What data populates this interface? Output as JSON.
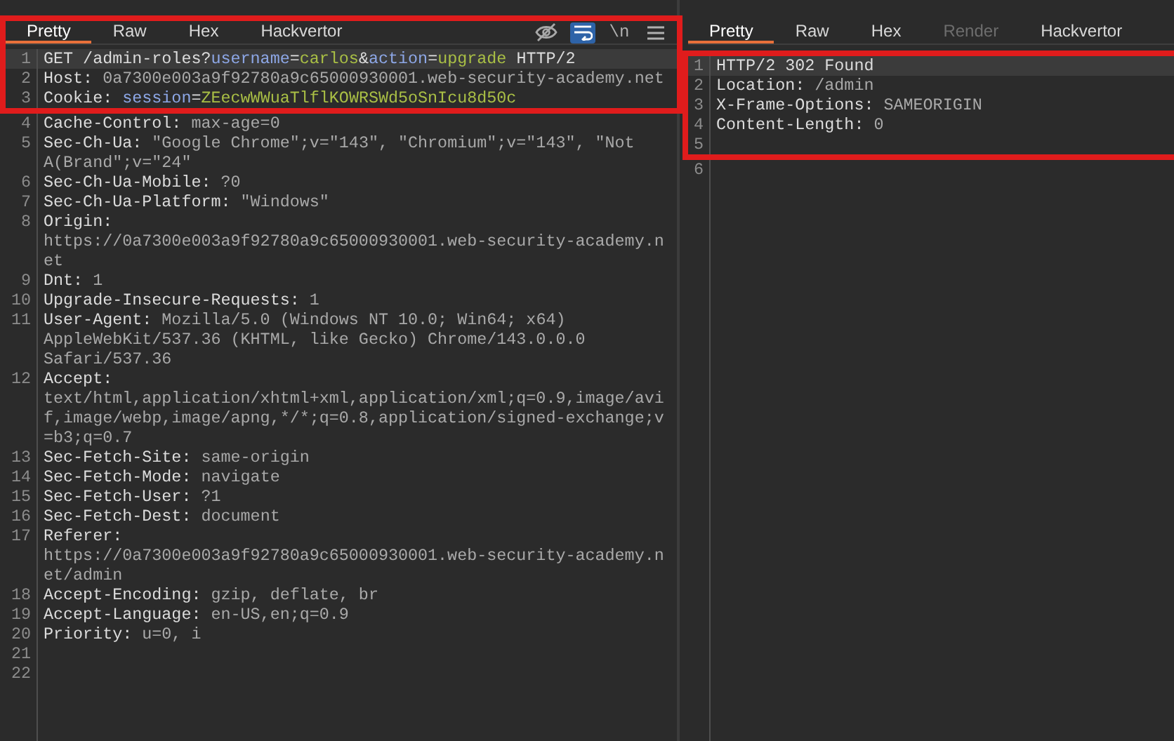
{
  "request": {
    "frame_includes_tabs": true,
    "tabs": [
      {
        "label": "Pretty",
        "selected": true,
        "disabled": false
      },
      {
        "label": "Raw",
        "selected": false,
        "disabled": false
      },
      {
        "label": "Hex",
        "selected": false,
        "disabled": false
      },
      {
        "label": "Hackvertor",
        "selected": false,
        "disabled": false
      }
    ],
    "toolbar": [
      {
        "kind": "hide_toggle",
        "on": false
      },
      {
        "kind": "wrap_toggle",
        "on": true
      },
      {
        "kind": "newline_toggle",
        "label": "\\n",
        "on": false
      },
      {
        "kind": "menu",
        "on": false
      }
    ],
    "framed_lines": [
      {
        "number": "1",
        "current": true,
        "rows": [
          [
            {
              "kind": "name",
              "text": "GET /admin-roles?"
            },
            {
              "kind": "param",
              "text": "username"
            },
            {
              "kind": "name",
              "text": "="
            },
            {
              "kind": "param_value",
              "text": "carlos"
            },
            {
              "kind": "name",
              "text": "&"
            },
            {
              "kind": "param",
              "text": "action"
            },
            {
              "kind": "name",
              "text": "="
            },
            {
              "kind": "param_value",
              "text": "upgrade"
            },
            {
              "kind": "name",
              "text": " HTTP/2"
            }
          ]
        ]
      },
      {
        "number": "2",
        "current": false,
        "rows": [
          [
            {
              "kind": "name",
              "text": "Host:"
            },
            {
              "kind": "value",
              "text": " 0a7300e003a9f92780a9c65000930001.web-security-academy.net"
            }
          ]
        ]
      },
      {
        "number": "3",
        "current": false,
        "rows": [
          [
            {
              "kind": "name",
              "text": "Cookie: "
            },
            {
              "kind": "param",
              "text": "session"
            },
            {
              "kind": "name",
              "text": "="
            },
            {
              "kind": "param_value",
              "text": "ZEecwWWuaTlflKOWRSWd5oSnIcu8d50c"
            }
          ]
        ]
      }
    ],
    "lines": [
      {
        "number": "4",
        "current": false,
        "rows": [
          [
            {
              "kind": "name",
              "text": "Cache-Control:"
            },
            {
              "kind": "value",
              "text": " max-age=0"
            }
          ]
        ]
      },
      {
        "number": "5",
        "current": false,
        "rows": [
          [
            {
              "kind": "name",
              "text": "Sec-Ch-Ua:"
            },
            {
              "kind": "value",
              "text": " \"Google Chrome\";v=\"143\", \"Chromium\";v=\"143\", \"Not"
            }
          ],
          [
            {
              "kind": "value",
              "text": "A(Brand\";v=\"24\""
            }
          ]
        ]
      },
      {
        "number": "6",
        "current": false,
        "rows": [
          [
            {
              "kind": "name",
              "text": "Sec-Ch-Ua-Mobile:"
            },
            {
              "kind": "value",
              "text": " ?0"
            }
          ]
        ]
      },
      {
        "number": "7",
        "current": false,
        "rows": [
          [
            {
              "kind": "name",
              "text": "Sec-Ch-Ua-Platform:"
            },
            {
              "kind": "value",
              "text": " \"Windows\""
            }
          ]
        ]
      },
      {
        "number": "8",
        "current": false,
        "rows": [
          [
            {
              "kind": "name",
              "text": "Origin:"
            }
          ],
          [
            {
              "kind": "value",
              "text": "https://0a7300e003a9f92780a9c65000930001.web-security-academy.n"
            }
          ],
          [
            {
              "kind": "value",
              "text": "et"
            }
          ]
        ]
      },
      {
        "number": "9",
        "current": false,
        "rows": [
          [
            {
              "kind": "name",
              "text": "Dnt:"
            },
            {
              "kind": "value",
              "text": " 1"
            }
          ]
        ]
      },
      {
        "number": "10",
        "current": false,
        "rows": [
          [
            {
              "kind": "name",
              "text": "Upgrade-Insecure-Requests:"
            },
            {
              "kind": "value",
              "text": " 1"
            }
          ]
        ]
      },
      {
        "number": "11",
        "current": false,
        "rows": [
          [
            {
              "kind": "name",
              "text": "User-Agent:"
            },
            {
              "kind": "value",
              "text": " Mozilla/5.0 (Windows NT 10.0; Win64; x64)"
            }
          ],
          [
            {
              "kind": "value",
              "text": "AppleWebKit/537.36 (KHTML, like Gecko) Chrome/143.0.0.0"
            }
          ],
          [
            {
              "kind": "value",
              "text": "Safari/537.36"
            }
          ]
        ]
      },
      {
        "number": "12",
        "current": false,
        "rows": [
          [
            {
              "kind": "name",
              "text": "Accept:"
            }
          ],
          [
            {
              "kind": "value",
              "text": "text/html,application/xhtml+xml,application/xml;q=0.9,image/avi"
            }
          ],
          [
            {
              "kind": "value",
              "text": "f,image/webp,image/apng,*/*;q=0.8,application/signed-exchange;v"
            }
          ],
          [
            {
              "kind": "value",
              "text": "=b3;q=0.7"
            }
          ]
        ]
      },
      {
        "number": "13",
        "current": false,
        "rows": [
          [
            {
              "kind": "name",
              "text": "Sec-Fetch-Site:"
            },
            {
              "kind": "value",
              "text": " same-origin"
            }
          ]
        ]
      },
      {
        "number": "14",
        "current": false,
        "rows": [
          [
            {
              "kind": "name",
              "text": "Sec-Fetch-Mode:"
            },
            {
              "kind": "value",
              "text": " navigate"
            }
          ]
        ]
      },
      {
        "number": "15",
        "current": false,
        "rows": [
          [
            {
              "kind": "name",
              "text": "Sec-Fetch-User:"
            },
            {
              "kind": "value",
              "text": " ?1"
            }
          ]
        ]
      },
      {
        "number": "16",
        "current": false,
        "rows": [
          [
            {
              "kind": "name",
              "text": "Sec-Fetch-Dest:"
            },
            {
              "kind": "value",
              "text": " document"
            }
          ]
        ]
      },
      {
        "number": "17",
        "current": false,
        "rows": [
          [
            {
              "kind": "name",
              "text": "Referer:"
            }
          ],
          [
            {
              "kind": "value",
              "text": "https://0a7300e003a9f92780a9c65000930001.web-security-academy.n"
            }
          ],
          [
            {
              "kind": "value",
              "text": "et/admin"
            }
          ]
        ]
      },
      {
        "number": "18",
        "current": false,
        "rows": [
          [
            {
              "kind": "name",
              "text": "Accept-Encoding:"
            },
            {
              "kind": "value",
              "text": " gzip, deflate, br"
            }
          ]
        ]
      },
      {
        "number": "19",
        "current": false,
        "rows": [
          [
            {
              "kind": "name",
              "text": "Accept-Language:"
            },
            {
              "kind": "value",
              "text": " en-US,en;q=0.9"
            }
          ]
        ]
      },
      {
        "number": "20",
        "current": false,
        "rows": [
          [
            {
              "kind": "name",
              "text": "Priority:"
            },
            {
              "kind": "value",
              "text": " u=0, i"
            }
          ]
        ]
      },
      {
        "number": "21",
        "current": false
      },
      {
        "number": "22",
        "current": false
      }
    ]
  },
  "response": {
    "frame_includes_tabs": false,
    "tabs": [
      {
        "label": "Pretty",
        "selected": true,
        "disabled": false
      },
      {
        "label": "Raw",
        "selected": false,
        "disabled": false
      },
      {
        "label": "Hex",
        "selected": false,
        "disabled": false
      },
      {
        "label": "Render",
        "selected": false,
        "disabled": true
      },
      {
        "label": "Hackvertor",
        "selected": false,
        "disabled": false
      }
    ],
    "framed_lines": [
      {
        "number": "1",
        "current": true,
        "rows": [
          [
            {
              "kind": "name",
              "text": "HTTP/2 302 Found"
            }
          ]
        ]
      },
      {
        "number": "2",
        "current": false,
        "rows": [
          [
            {
              "kind": "name",
              "text": "Location:"
            },
            {
              "kind": "value",
              "text": " /admin"
            }
          ]
        ]
      },
      {
        "number": "3",
        "current": false,
        "rows": [
          [
            {
              "kind": "name",
              "text": "X-Frame-Options:"
            },
            {
              "kind": "value",
              "text": " SAMEORIGIN"
            }
          ]
        ]
      },
      {
        "number": "4",
        "current": false,
        "rows": [
          [
            {
              "kind": "name",
              "text": "Content-Length:"
            },
            {
              "kind": "value",
              "text": " 0"
            }
          ]
        ]
      },
      {
        "number": "5",
        "current": false
      }
    ],
    "lines": [
      {
        "number": "6",
        "current": false
      }
    ]
  }
}
